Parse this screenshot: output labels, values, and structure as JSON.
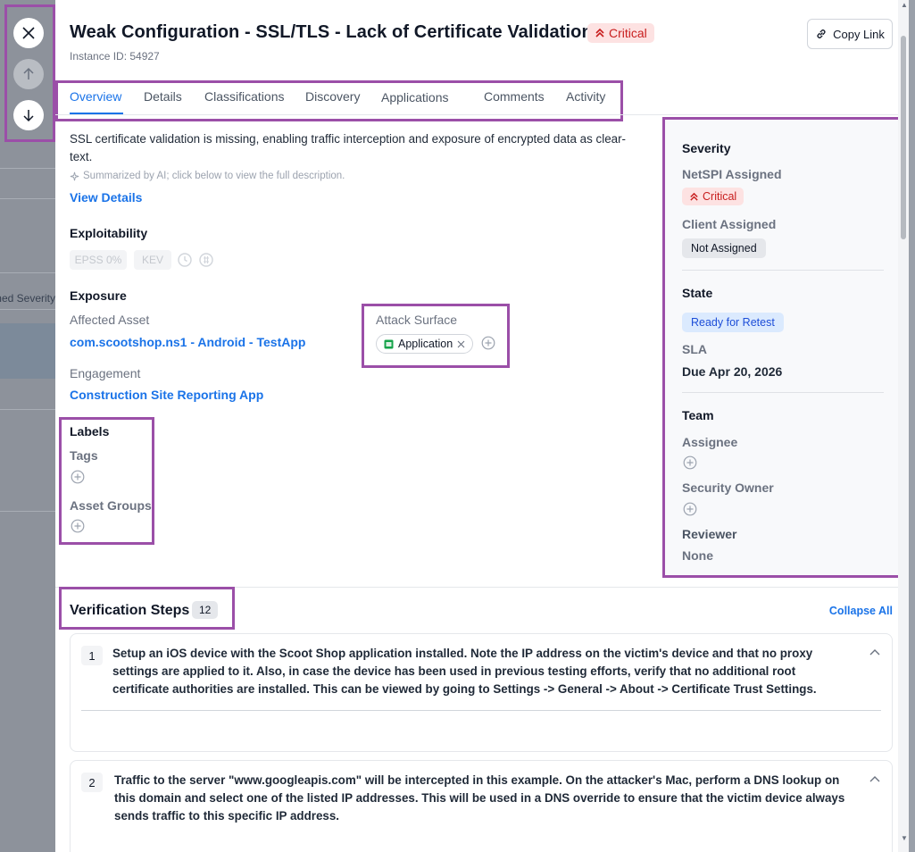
{
  "background": {
    "partial_column_text": "ned Severity"
  },
  "nav": {
    "close_icon": "close-icon",
    "prev_icon": "arrow-up-icon",
    "next_icon": "arrow-down-icon"
  },
  "header": {
    "title": "Weak Configuration - SSL/TLS - Lack of Certificate Validation",
    "severity_badge": "Critical",
    "instance": "Instance ID: 54927",
    "copy_link": "Copy Link"
  },
  "tabs": [
    {
      "label": "Overview",
      "active": true
    },
    {
      "label": "Details"
    },
    {
      "label": "Classifications"
    },
    {
      "label": "Discovery"
    },
    {
      "label": "Applications"
    },
    {
      "label": "Comments"
    },
    {
      "label": "Activity"
    }
  ],
  "overview": {
    "summary": "SSL certificate validation is missing, enabling traffic interception and exposure of encrypted data as clear-text.",
    "ai_note": "Summarized by AI; click below to view the full description.",
    "view_details": "View Details",
    "exploitability": {
      "heading": "Exploitability",
      "epss": "EPSS 0%",
      "kev": "KEV"
    },
    "exposure": {
      "heading": "Exposure",
      "affected_asset_label": "Affected Asset",
      "affected_asset": "com.scootshop.ns1 - Android - TestApp",
      "engagement_label": "Engagement",
      "engagement": "Construction Site Reporting App",
      "attack_surface_label": "Attack Surface",
      "attack_surface_chip": "Application"
    },
    "labels": {
      "heading": "Labels",
      "tags_label": "Tags",
      "asset_groups_label": "Asset Groups"
    }
  },
  "sidebar": {
    "severity_heading": "Severity",
    "netspi_assigned_label": "NetSPI Assigned",
    "netspi_assigned_value": "Critical",
    "client_assigned_label": "Client Assigned",
    "client_assigned_value": "Not Assigned",
    "state_heading": "State",
    "state_value": "Ready for Retest",
    "sla_label": "SLA",
    "sla_value": "Due Apr 20, 2026",
    "team_heading": "Team",
    "assignee_label": "Assignee",
    "security_owner_label": "Security Owner",
    "reviewer_label": "Reviewer",
    "reviewer_value": "None"
  },
  "verification": {
    "title": "Verification Steps",
    "count": "12",
    "collapse_all": "Collapse All",
    "steps": [
      {
        "num": "1",
        "text": "Setup an iOS device with the Scoot Shop application installed. Note the IP address on the victim's device and that no proxy settings are applied to it. Also, in case the device has been used in previous testing efforts, verify that no additional root certificate authorities are installed. This can be viewed by going to Settings -> General -> About -> Certificate Trust Settings."
      },
      {
        "num": "2",
        "text": "Traffic to the server \"www.googleapis.com\" will be intercepted in this example. On the attacker's Mac, perform a DNS lookup on this domain and select one of the listed IP addresses. This will be used in a DNS override to ensure that the victim device always sends traffic to this specific IP address."
      }
    ]
  },
  "colors": {
    "accent": "#1a73e8",
    "critical": "#c81e1e",
    "highlight_outline": "#9b4fa8"
  }
}
